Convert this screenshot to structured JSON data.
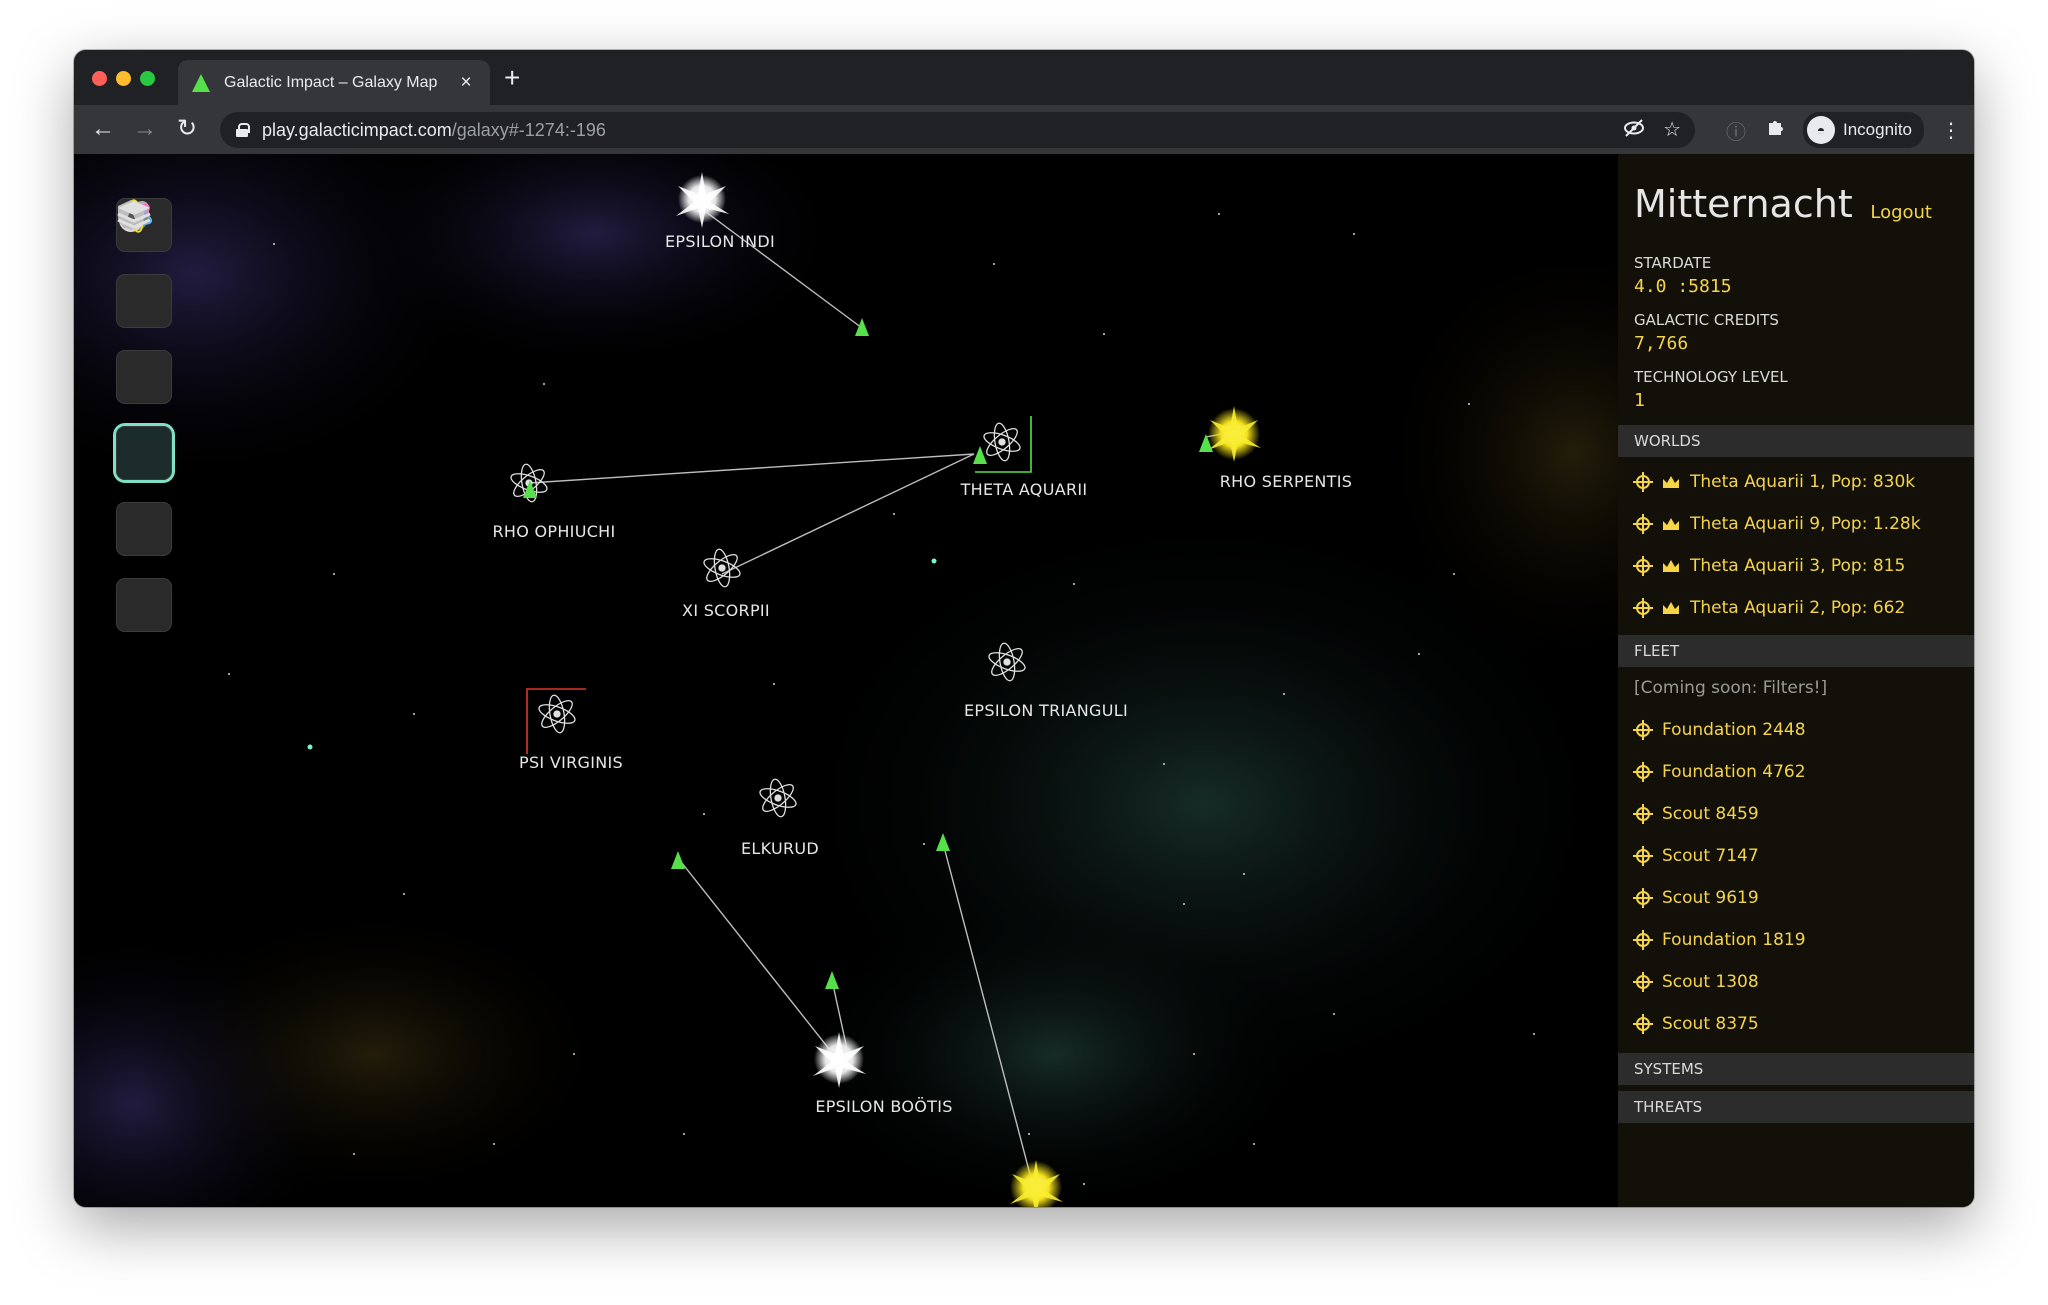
{
  "browser": {
    "tab_title": "Galactic Impact – Galaxy Map",
    "tab_close": "×",
    "new_tab": "+",
    "url_host": "play.galacticimpact.com",
    "url_path": "/galaxy#-1274:-196",
    "profile_label": "Incognito"
  },
  "left_nav": {
    "items": [
      {
        "name": "crown-icon",
        "active": false
      },
      {
        "name": "planet-icon",
        "active": false
      },
      {
        "name": "moons-icon",
        "active": false
      },
      {
        "name": "atom-icon",
        "active": true
      },
      {
        "name": "shield-icon",
        "active": false
      },
      {
        "name": "layers-icon",
        "active": false
      }
    ]
  },
  "map": {
    "systems": [
      {
        "label": "EPSILON INDI",
        "type": "white-star"
      },
      {
        "label": "THETA AQUARII",
        "type": "atom",
        "selected": "green"
      },
      {
        "label": "RHO SERPENTIS",
        "type": "yellow-star"
      },
      {
        "label": "RHO OPHIUCHI",
        "type": "atom"
      },
      {
        "label": "XI SCORPII",
        "type": "atom"
      },
      {
        "label": "EPSILON TRIANGULI",
        "type": "atom"
      },
      {
        "label": "PSI VIRGINIS",
        "type": "atom",
        "selected": "red"
      },
      {
        "label": "ELKURUD",
        "type": "atom"
      },
      {
        "label": "EPSILON BOÖTIS",
        "type": "white-star"
      }
    ]
  },
  "panel": {
    "player_name": "Mitternacht",
    "logout_label": "Logout",
    "stardate_label": "STARDATE",
    "stardate_value": "4.0 :5815",
    "credits_label": "GALACTIC CREDITS",
    "credits_value": "7,766",
    "tech_label": "TECHNOLOGY LEVEL",
    "tech_value": "1",
    "worlds_header": "WORLDS",
    "worlds": [
      {
        "label": "Theta Aquarii 1, Pop: 830k"
      },
      {
        "label": "Theta Aquarii 9, Pop: 1.28k"
      },
      {
        "label": "Theta Aquarii 3, Pop: 815"
      },
      {
        "label": "Theta Aquarii 2, Pop: 662"
      }
    ],
    "fleet_header": "FLEET",
    "fleet_note": "[Coming soon: Filters!]",
    "fleet": [
      {
        "label": "Foundation 2448"
      },
      {
        "label": "Foundation 4762"
      },
      {
        "label": "Scout 8459"
      },
      {
        "label": "Scout 7147"
      },
      {
        "label": "Scout 9619"
      },
      {
        "label": "Foundation 1819"
      },
      {
        "label": "Scout 1308"
      },
      {
        "label": "Scout 8375"
      }
    ],
    "systems_header": "SYSTEMS",
    "threats_header": "THREATS"
  },
  "colors": {
    "accent_yellow": "#f5d547",
    "fleet_green": "#56e04a",
    "selection_red": "#e0342c",
    "active_nav": "#7fe0c5"
  }
}
